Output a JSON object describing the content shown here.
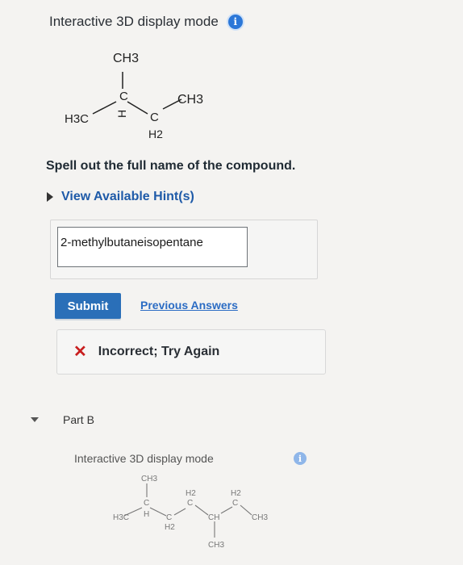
{
  "part_a": {
    "display_mode_title": "Interactive 3D display mode",
    "molecule_labels": {
      "top_ch3": "CH3",
      "c_center": "C",
      "h_center": "H",
      "right_ch3": "CH3",
      "left_h3c": "H3C",
      "c_bottom": "C",
      "h2_bottom": "H2"
    },
    "question": "Spell out the full name of the compound.",
    "hint_label": "View Available Hint(s)",
    "answer_value": "2-methylbutaneisopentane",
    "submit_label": "Submit",
    "previous_answers_label": "Previous Answers",
    "feedback": "Incorrect; Try Again"
  },
  "part_b": {
    "label": "Part B",
    "display_mode_title": "Interactive 3D display mode",
    "molecule_labels": {
      "top_ch3": "CH3",
      "h3c": "H3C",
      "c1": "C",
      "h1": "H",
      "c2": "C",
      "h2_c2": "H2",
      "h2_c3": "H2",
      "c3": "C",
      "ch_center": "CH",
      "ch3_bottom": "CH3",
      "h2_c4": "H2",
      "c4": "C",
      "ch3_right": "CH3"
    }
  },
  "colors": {
    "accent": "#2a6fb8",
    "link": "#2b6cc4",
    "error": "#c81e1e",
    "info": "#2b77d8"
  }
}
